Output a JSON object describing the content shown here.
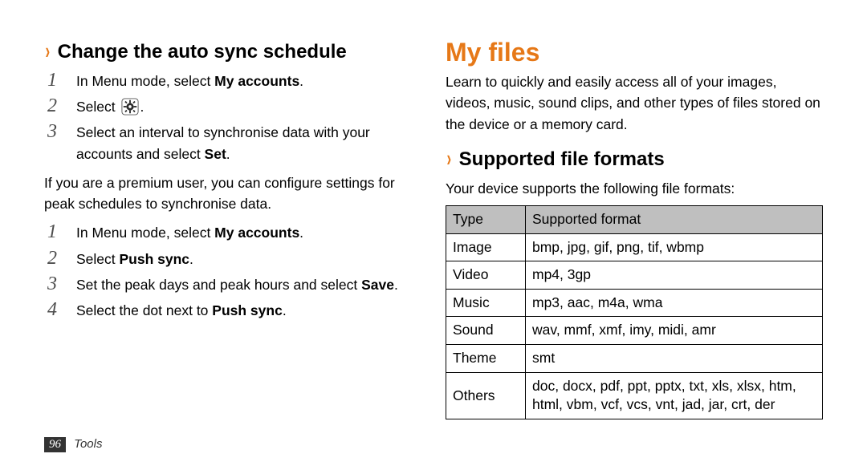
{
  "left": {
    "subheading": "Change the auto sync schedule",
    "steps1": [
      {
        "pre": "In Menu mode, select ",
        "bold": "My accounts",
        "post": "."
      },
      {
        "pre": "Select ",
        "icon": "gear",
        "post": "."
      },
      {
        "pre": "Select an interval to synchronise data with your accounts and select ",
        "bold": "Set",
        "post": "."
      }
    ],
    "note": "If you are a premium user, you can configure settings for peak schedules to synchronise data.",
    "steps2": [
      {
        "pre": "In Menu mode, select ",
        "bold": "My accounts",
        "post": "."
      },
      {
        "pre": "Select ",
        "bold": "Push sync",
        "post": "."
      },
      {
        "pre": "Set the peak days and peak hours and select ",
        "bold": "Save",
        "post": "."
      },
      {
        "pre": "Select the dot next to ",
        "bold": "Push sync",
        "post": "."
      }
    ]
  },
  "right": {
    "section_title": "My files",
    "intro": "Learn to quickly and easily access all of your images, videos, music, sound clips, and other types of files stored on the device or a memory card.",
    "subheading": "Supported file formats",
    "lead": "Your device supports the following file formats:",
    "table": {
      "headers": [
        "Type",
        "Supported format"
      ],
      "rows": [
        [
          "Image",
          "bmp, jpg, gif, png, tif, wbmp"
        ],
        [
          "Video",
          "mp4, 3gp"
        ],
        [
          "Music",
          "mp3, aac, m4a, wma"
        ],
        [
          "Sound",
          "wav, mmf, xmf, imy, midi, amr"
        ],
        [
          "Theme",
          "smt"
        ],
        [
          "Others",
          "doc, docx, pdf, ppt, pptx, txt, xls, xlsx, htm, html, vbm, vcf, vcs, vnt, jad, jar, crt, der"
        ]
      ]
    }
  },
  "footer": {
    "page": "96",
    "chapter": "Tools"
  }
}
